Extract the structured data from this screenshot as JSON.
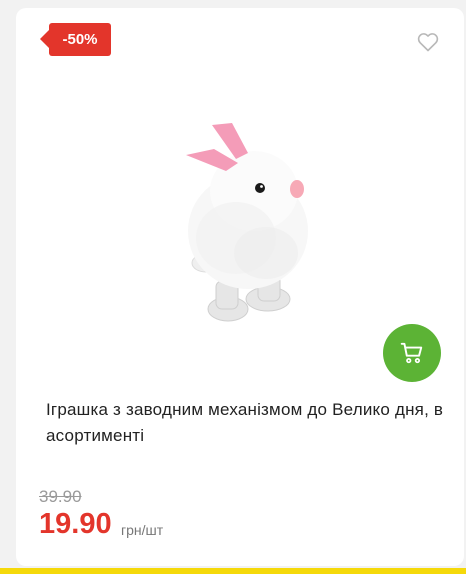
{
  "product": {
    "discount_badge": "-50%",
    "title": "Іграшка з заводним механізмом до Велико дня, в асортименті",
    "old_price": "39.90",
    "price": "19.90",
    "unit": "грн/шт"
  },
  "icons": {
    "wishlist": "heart-outline-icon",
    "cart": "shopping-cart-icon"
  },
  "colors": {
    "badge": "#e3352b",
    "price": "#e3352b",
    "cart_button": "#5cb335",
    "bottom_strip": "#f5d90a"
  }
}
